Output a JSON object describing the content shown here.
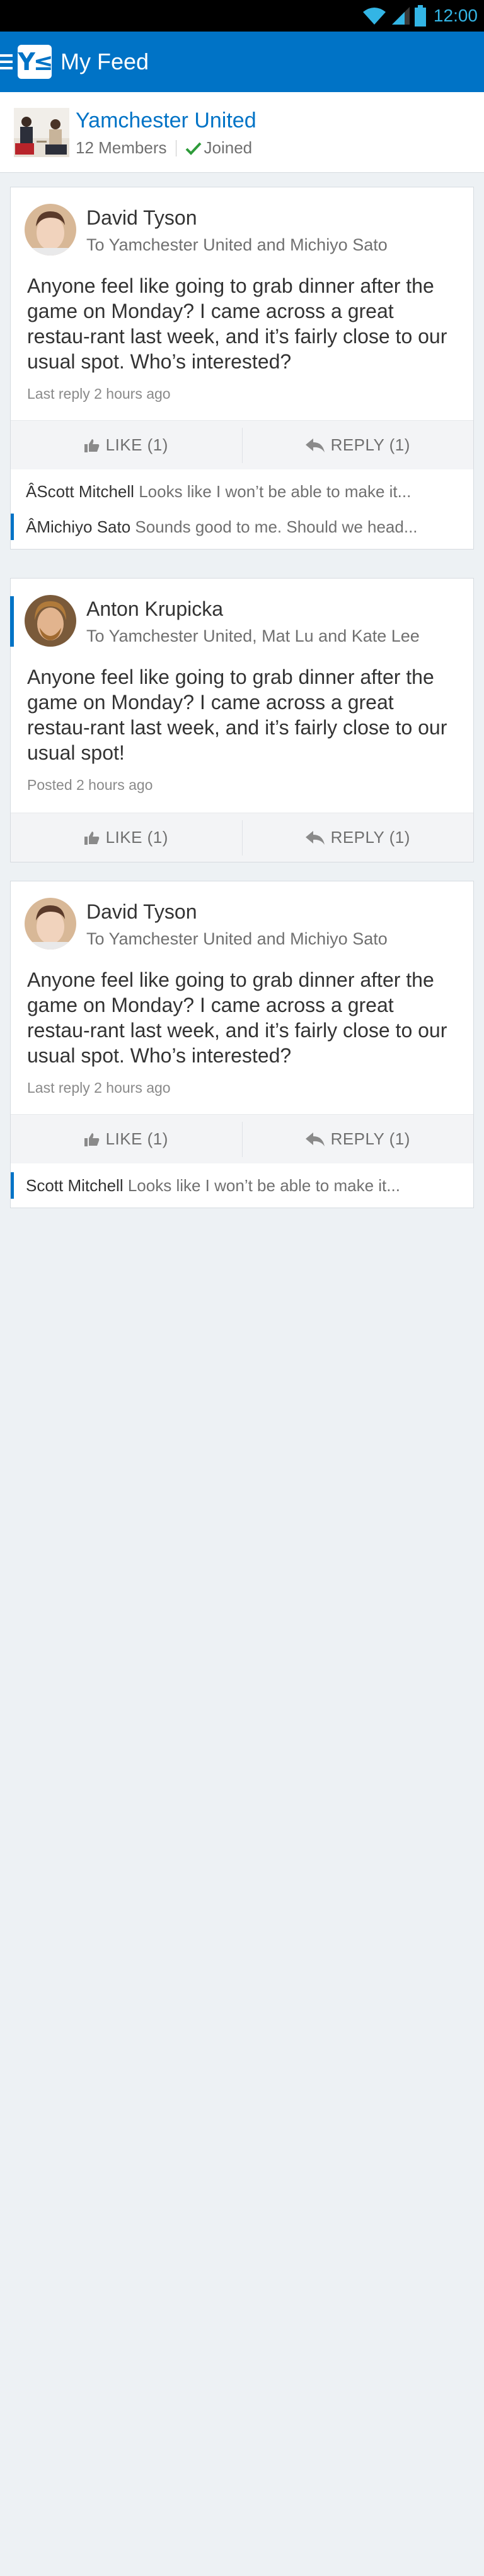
{
  "status_bar": {
    "time": "12:00",
    "accent_color": "#33b5e5"
  },
  "app_bar": {
    "title": "My Feed",
    "logo_text": "Y≤",
    "color": "#0073c6"
  },
  "group": {
    "name": "Yamchester United",
    "members": "12 Members",
    "joined": "Joined",
    "joined_color": "#2e9b3a"
  },
  "posts": [
    {
      "author": "David Tyson",
      "recipients": "To Yamchester United and Michiyo Sato",
      "body": "Anyone feel like going to grab dinner after the game on Monday? I came across a great restau-rant last week, and it’s fairly close to our usual spot. Who’s interested?",
      "time": "Last reply 2 hours ago",
      "like": "LIKE (1)",
      "reply": "REPLY (1)",
      "replies": [
        {
          "author": "ÂScott Mitchell",
          "text": "Looks like I won’t be able to make it..."
        },
        {
          "author": "ÂMichiyo Sato",
          "text": "Sounds good to me. Should we head..."
        }
      ]
    },
    {
      "author": "Anton Krupicka",
      "recipients": "To Yamchester United, Mat Lu and Kate Lee",
      "body": "Anyone feel like going to grab dinner after the game on Monday? I came across a great restau-rant last week, and it’s fairly close to our usual spot!",
      "time": "Posted 2 hours ago",
      "like": "LIKE (1)",
      "reply": "REPLY (1)"
    },
    {
      "author": "David Tyson",
      "recipients": "To Yamchester United and Michiyo Sato",
      "body": "Anyone feel like going to grab dinner after the game on Monday? I came across a great restau-rant last week, and it’s fairly close to our usual spot. Who’s interested?",
      "time": "Last reply 2 hours ago",
      "like": "LIKE (1)",
      "reply": "REPLY (1)",
      "replies": [
        {
          "author": "Scott Mitchell",
          "text": "Looks like I won’t be able to make it..."
        }
      ]
    }
  ]
}
